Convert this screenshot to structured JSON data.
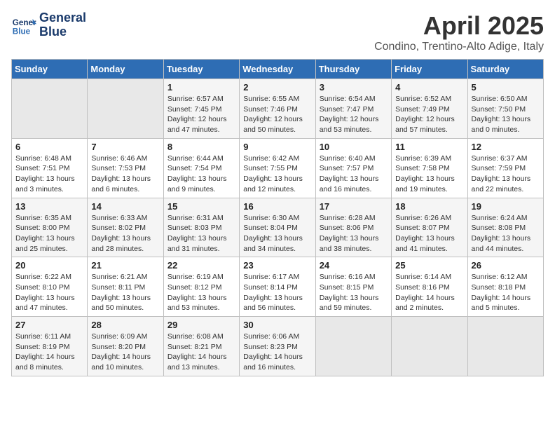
{
  "header": {
    "logo_line1": "General",
    "logo_line2": "Blue",
    "title": "April 2025",
    "subtitle": "Condino, Trentino-Alto Adige, Italy"
  },
  "days_of_week": [
    "Sunday",
    "Monday",
    "Tuesday",
    "Wednesday",
    "Thursday",
    "Friday",
    "Saturday"
  ],
  "weeks": [
    [
      {
        "day": "",
        "info": ""
      },
      {
        "day": "",
        "info": ""
      },
      {
        "day": "1",
        "info": "Sunrise: 6:57 AM\nSunset: 7:45 PM\nDaylight: 12 hours and 47 minutes."
      },
      {
        "day": "2",
        "info": "Sunrise: 6:55 AM\nSunset: 7:46 PM\nDaylight: 12 hours and 50 minutes."
      },
      {
        "day": "3",
        "info": "Sunrise: 6:54 AM\nSunset: 7:47 PM\nDaylight: 12 hours and 53 minutes."
      },
      {
        "day": "4",
        "info": "Sunrise: 6:52 AM\nSunset: 7:49 PM\nDaylight: 12 hours and 57 minutes."
      },
      {
        "day": "5",
        "info": "Sunrise: 6:50 AM\nSunset: 7:50 PM\nDaylight: 13 hours and 0 minutes."
      }
    ],
    [
      {
        "day": "6",
        "info": "Sunrise: 6:48 AM\nSunset: 7:51 PM\nDaylight: 13 hours and 3 minutes."
      },
      {
        "day": "7",
        "info": "Sunrise: 6:46 AM\nSunset: 7:53 PM\nDaylight: 13 hours and 6 minutes."
      },
      {
        "day": "8",
        "info": "Sunrise: 6:44 AM\nSunset: 7:54 PM\nDaylight: 13 hours and 9 minutes."
      },
      {
        "day": "9",
        "info": "Sunrise: 6:42 AM\nSunset: 7:55 PM\nDaylight: 13 hours and 12 minutes."
      },
      {
        "day": "10",
        "info": "Sunrise: 6:40 AM\nSunset: 7:57 PM\nDaylight: 13 hours and 16 minutes."
      },
      {
        "day": "11",
        "info": "Sunrise: 6:39 AM\nSunset: 7:58 PM\nDaylight: 13 hours and 19 minutes."
      },
      {
        "day": "12",
        "info": "Sunrise: 6:37 AM\nSunset: 7:59 PM\nDaylight: 13 hours and 22 minutes."
      }
    ],
    [
      {
        "day": "13",
        "info": "Sunrise: 6:35 AM\nSunset: 8:00 PM\nDaylight: 13 hours and 25 minutes."
      },
      {
        "day": "14",
        "info": "Sunrise: 6:33 AM\nSunset: 8:02 PM\nDaylight: 13 hours and 28 minutes."
      },
      {
        "day": "15",
        "info": "Sunrise: 6:31 AM\nSunset: 8:03 PM\nDaylight: 13 hours and 31 minutes."
      },
      {
        "day": "16",
        "info": "Sunrise: 6:30 AM\nSunset: 8:04 PM\nDaylight: 13 hours and 34 minutes."
      },
      {
        "day": "17",
        "info": "Sunrise: 6:28 AM\nSunset: 8:06 PM\nDaylight: 13 hours and 38 minutes."
      },
      {
        "day": "18",
        "info": "Sunrise: 6:26 AM\nSunset: 8:07 PM\nDaylight: 13 hours and 41 minutes."
      },
      {
        "day": "19",
        "info": "Sunrise: 6:24 AM\nSunset: 8:08 PM\nDaylight: 13 hours and 44 minutes."
      }
    ],
    [
      {
        "day": "20",
        "info": "Sunrise: 6:22 AM\nSunset: 8:10 PM\nDaylight: 13 hours and 47 minutes."
      },
      {
        "day": "21",
        "info": "Sunrise: 6:21 AM\nSunset: 8:11 PM\nDaylight: 13 hours and 50 minutes."
      },
      {
        "day": "22",
        "info": "Sunrise: 6:19 AM\nSunset: 8:12 PM\nDaylight: 13 hours and 53 minutes."
      },
      {
        "day": "23",
        "info": "Sunrise: 6:17 AM\nSunset: 8:14 PM\nDaylight: 13 hours and 56 minutes."
      },
      {
        "day": "24",
        "info": "Sunrise: 6:16 AM\nSunset: 8:15 PM\nDaylight: 13 hours and 59 minutes."
      },
      {
        "day": "25",
        "info": "Sunrise: 6:14 AM\nSunset: 8:16 PM\nDaylight: 14 hours and 2 minutes."
      },
      {
        "day": "26",
        "info": "Sunrise: 6:12 AM\nSunset: 8:18 PM\nDaylight: 14 hours and 5 minutes."
      }
    ],
    [
      {
        "day": "27",
        "info": "Sunrise: 6:11 AM\nSunset: 8:19 PM\nDaylight: 14 hours and 8 minutes."
      },
      {
        "day": "28",
        "info": "Sunrise: 6:09 AM\nSunset: 8:20 PM\nDaylight: 14 hours and 10 minutes."
      },
      {
        "day": "29",
        "info": "Sunrise: 6:08 AM\nSunset: 8:21 PM\nDaylight: 14 hours and 13 minutes."
      },
      {
        "day": "30",
        "info": "Sunrise: 6:06 AM\nSunset: 8:23 PM\nDaylight: 14 hours and 16 minutes."
      },
      {
        "day": "",
        "info": ""
      },
      {
        "day": "",
        "info": ""
      },
      {
        "day": "",
        "info": ""
      }
    ]
  ]
}
